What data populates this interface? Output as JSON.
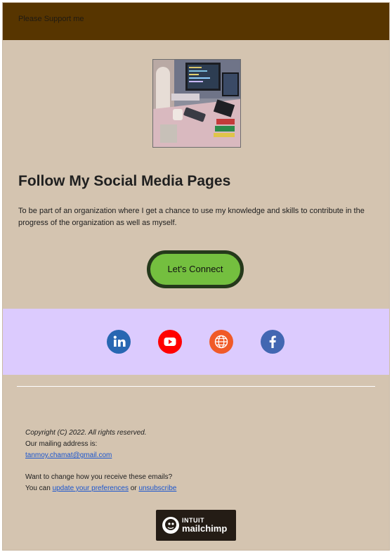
{
  "header": {
    "text": "Please Support me"
  },
  "colors": {
    "page_bg": "#d4c4b0",
    "header_bg": "#573500",
    "button_bg": "#74bf3f",
    "button_border": "#25391b",
    "social_band_bg": "#dccbfe",
    "link": "#1a55cf"
  },
  "hero": {
    "image_icon": "desk-setup-photo"
  },
  "main": {
    "title": "Follow My Social Media Pages",
    "body": "To be part of an organization where I get a chance to use my knowledge and skills to contribute in the progress of the organization as well as myself.",
    "button_label": "Let's Connect"
  },
  "social": {
    "items": [
      {
        "icon": "linkedin-icon",
        "color": "#2867b2"
      },
      {
        "icon": "youtube-icon",
        "color": "#ff0000"
      },
      {
        "icon": "website-globe-icon",
        "color": "#f05a28"
      },
      {
        "icon": "facebook-icon",
        "color": "#4267b2"
      }
    ]
  },
  "footer": {
    "copyright": "Copyright (C) 2022. All rights reserved.",
    "mailing_label": "Our mailing address is:",
    "email": "tanmoy.chamat@gmail.com",
    "change_prompt": "Want to change how you receive these emails?",
    "you_can": "You can",
    "update_link": "update your preferences",
    "or": "or",
    "unsubscribe_link": "unsubscribe"
  },
  "badge": {
    "icon": "mailchimp-freddie-icon",
    "intuit": "INTUIT",
    "brand": "mailchimp"
  }
}
